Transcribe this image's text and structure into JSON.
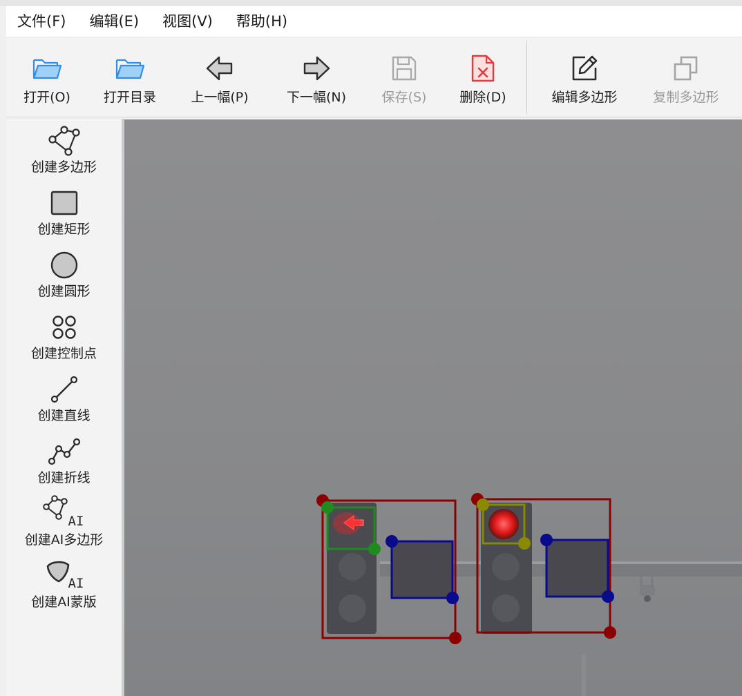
{
  "menu": [
    "文件(F)",
    "编辑(E)",
    "视图(V)",
    "帮助(H)"
  ],
  "toolbar": {
    "open": "打开(O)",
    "open_dir": "打开目录",
    "prev": "上一幅(P)",
    "next": "下一幅(N)",
    "save": "保存(S)",
    "delete": "删除(D)",
    "edit_polygon": "编辑多边形",
    "copy_polygon": "复制多边形"
  },
  "sidebar": {
    "create_polygon": "创建多边形",
    "create_rect": "创建矩形",
    "create_circle": "创建圆形",
    "create_point": "创建控制点",
    "create_line": "创建直线",
    "create_polyline": "创建折线",
    "create_ai_polygon": "创建AI多边形",
    "create_ai_mask": "创建AI蒙版",
    "ai_tag": "AI"
  },
  "colors": {
    "folder_blue": "#2f8ee6",
    "delete_red": "#e23b3b",
    "box_red": "#8b0000",
    "box_green": "#1f8b1f",
    "box_blue": "#0a0a8c",
    "box_yellow": "#8a8a00"
  }
}
